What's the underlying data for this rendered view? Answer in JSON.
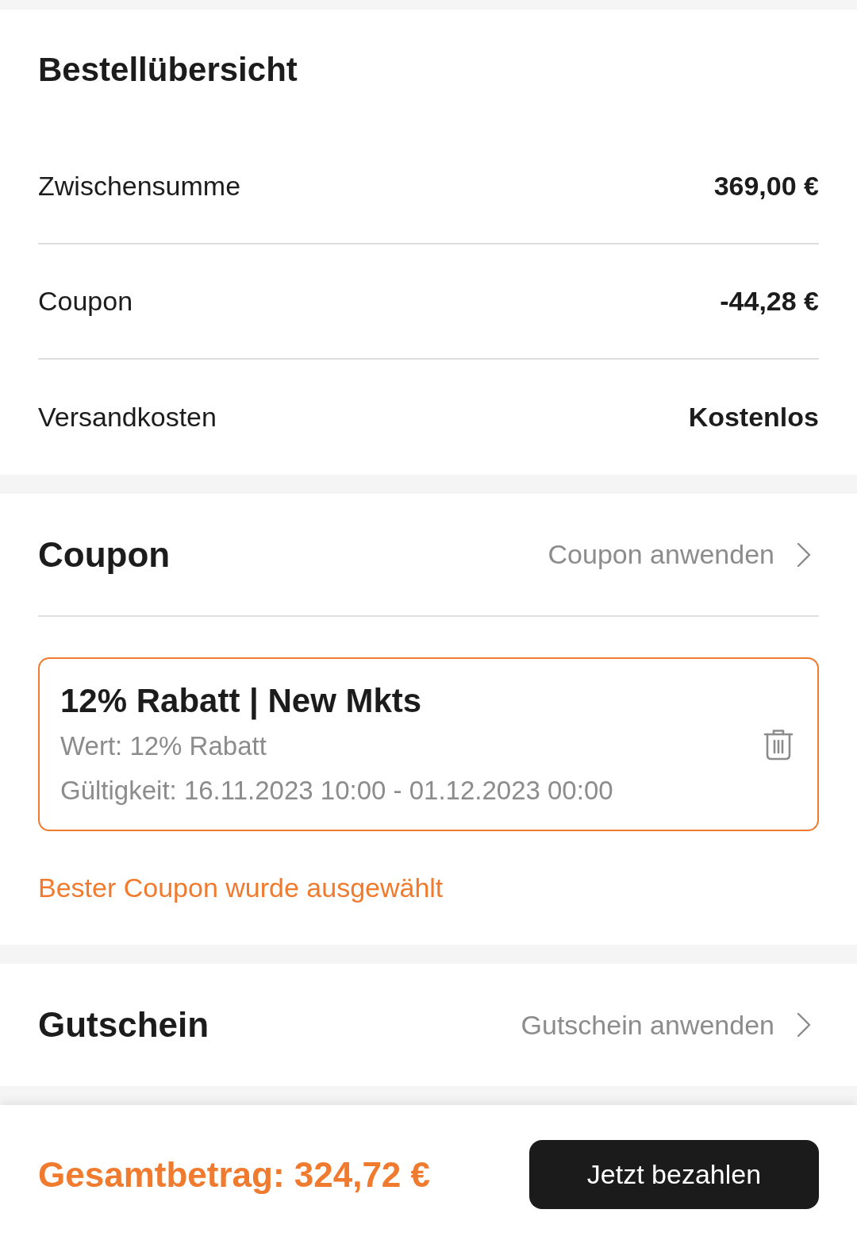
{
  "summary": {
    "title": "Bestellübersicht",
    "rows": [
      {
        "label": "Zwischensumme",
        "value": "369,00 €"
      },
      {
        "label": "Coupon",
        "value": "-44,28 €"
      },
      {
        "label": "Versandkosten",
        "value": "Kostenlos"
      }
    ]
  },
  "coupon_section": {
    "title": "Coupon",
    "action": "Coupon anwenden",
    "coupon": {
      "title": "12% Rabatt | New Mkts",
      "value": "Wert: 12% Rabatt",
      "validity": "Gültigkeit: 16.11.2023 10:00 - 01.12.2023 00:00",
      "selected": true
    },
    "note": "Bester Coupon wurde ausgewählt"
  },
  "voucher_section": {
    "title": "Gutschein",
    "action": "Gutschein anwenden"
  },
  "footer": {
    "total": "Gesamtbetrag: 324,72 €",
    "pay_button": "Jetzt bezahlen"
  }
}
